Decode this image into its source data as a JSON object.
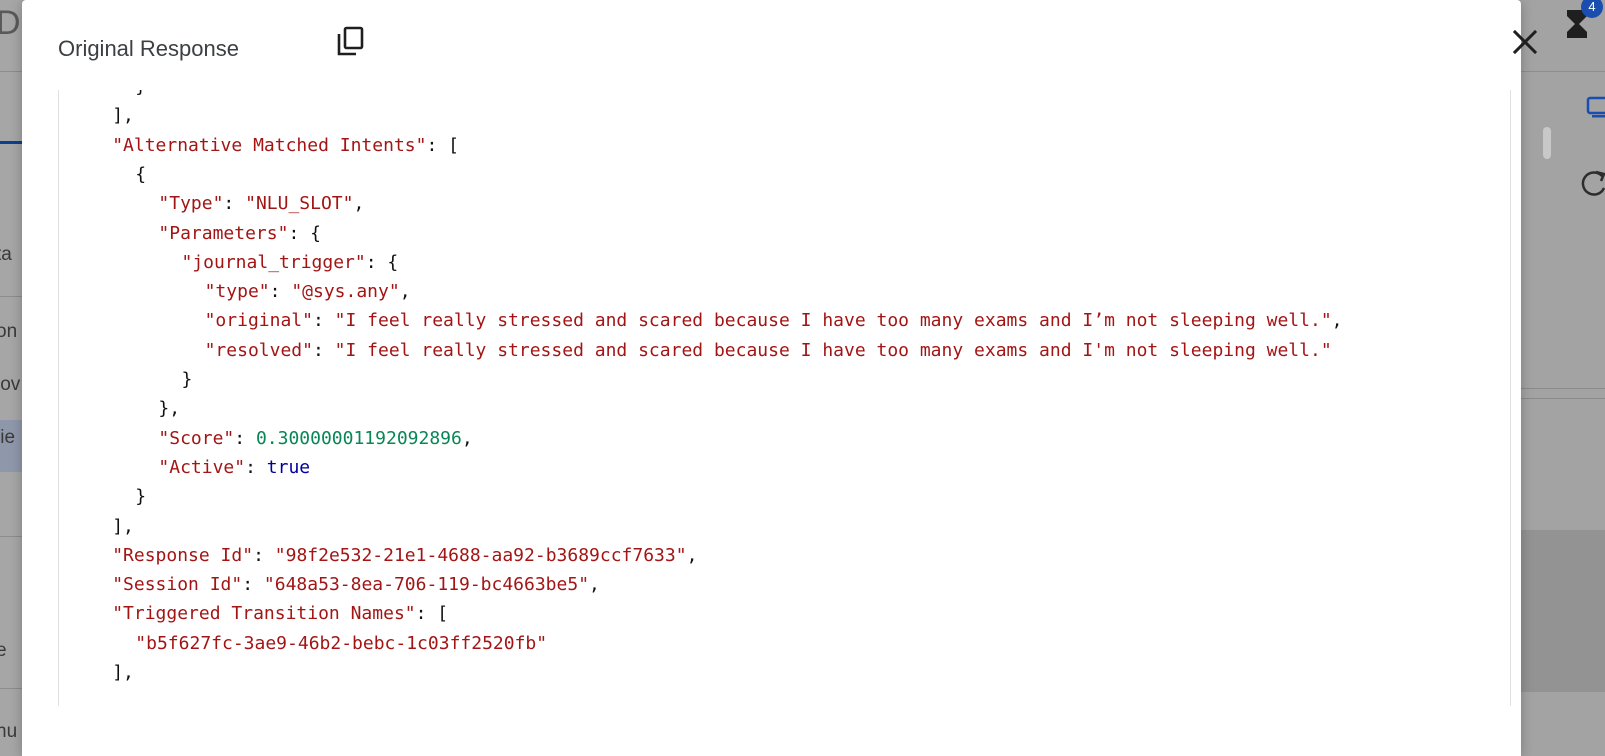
{
  "background": {
    "left_title_fragment": "Di",
    "left_items": [
      "ta",
      "on",
      "lov",
      "lie",
      "e",
      "nu"
    ],
    "notification_count": "4"
  },
  "dialog": {
    "title": "Original Response",
    "copy_icon": "copy-icon",
    "close_icon": "close-icon"
  },
  "code_lines": [
    {
      "indent": 3,
      "tokens": [
        {
          "t": "p",
          "v": "}"
        }
      ]
    },
    {
      "indent": 2,
      "tokens": [
        {
          "t": "p",
          "v": "],"
        }
      ]
    },
    {
      "indent": 2,
      "tokens": [
        {
          "t": "k",
          "v": "\"Alternative Matched Intents\""
        },
        {
          "t": "p",
          "v": ": ["
        }
      ]
    },
    {
      "indent": 3,
      "tokens": [
        {
          "t": "p",
          "v": "{"
        }
      ]
    },
    {
      "indent": 4,
      "tokens": [
        {
          "t": "k",
          "v": "\"Type\""
        },
        {
          "t": "p",
          "v": ": "
        },
        {
          "t": "s",
          "v": "\"NLU_SLOT\""
        },
        {
          "t": "p",
          "v": ","
        }
      ]
    },
    {
      "indent": 4,
      "tokens": [
        {
          "t": "k",
          "v": "\"Parameters\""
        },
        {
          "t": "p",
          "v": ": {"
        }
      ]
    },
    {
      "indent": 5,
      "tokens": [
        {
          "t": "k",
          "v": "\"journal_trigger\""
        },
        {
          "t": "p",
          "v": ": {"
        }
      ]
    },
    {
      "indent": 6,
      "tokens": [
        {
          "t": "k",
          "v": "\"type\""
        },
        {
          "t": "p",
          "v": ": "
        },
        {
          "t": "s",
          "v": "\"@sys.any\""
        },
        {
          "t": "p",
          "v": ","
        }
      ]
    },
    {
      "indent": 6,
      "tokens": [
        {
          "t": "k",
          "v": "\"original\""
        },
        {
          "t": "p",
          "v": ": "
        },
        {
          "t": "s",
          "v": "\"I feel really stressed and scared because I have too many exams and I’m not sleeping well.\""
        },
        {
          "t": "p",
          "v": ","
        }
      ]
    },
    {
      "indent": 6,
      "tokens": [
        {
          "t": "k",
          "v": "\"resolved\""
        },
        {
          "t": "p",
          "v": ": "
        },
        {
          "t": "s",
          "v": "\"I feel really stressed and scared because I have too many exams and I'm not sleeping well.\""
        }
      ]
    },
    {
      "indent": 5,
      "tokens": [
        {
          "t": "p",
          "v": "}"
        }
      ]
    },
    {
      "indent": 4,
      "tokens": [
        {
          "t": "p",
          "v": "},"
        }
      ]
    },
    {
      "indent": 4,
      "tokens": [
        {
          "t": "k",
          "v": "\"Score\""
        },
        {
          "t": "p",
          "v": ": "
        },
        {
          "t": "n",
          "v": "0.30000001192092896"
        },
        {
          "t": "p",
          "v": ","
        }
      ]
    },
    {
      "indent": 4,
      "tokens": [
        {
          "t": "k",
          "v": "\"Active\""
        },
        {
          "t": "p",
          "v": ": "
        },
        {
          "t": "b",
          "v": "true"
        }
      ]
    },
    {
      "indent": 3,
      "tokens": [
        {
          "t": "p",
          "v": "}"
        }
      ]
    },
    {
      "indent": 2,
      "tokens": [
        {
          "t": "p",
          "v": "],"
        }
      ]
    },
    {
      "indent": 2,
      "tokens": [
        {
          "t": "k",
          "v": "\"Response Id\""
        },
        {
          "t": "p",
          "v": ": "
        },
        {
          "t": "s",
          "v": "\"98f2e532-21e1-4688-aa92-b3689ccf7633\""
        },
        {
          "t": "p",
          "v": ","
        }
      ]
    },
    {
      "indent": 2,
      "tokens": [
        {
          "t": "k",
          "v": "\"Session Id\""
        },
        {
          "t": "p",
          "v": ": "
        },
        {
          "t": "s",
          "v": "\"648a53-8ea-706-119-bc4663be5\""
        },
        {
          "t": "p",
          "v": ","
        }
      ]
    },
    {
      "indent": 2,
      "tokens": [
        {
          "t": "k",
          "v": "\"Triggered Transition Names\""
        },
        {
          "t": "p",
          "v": ": ["
        }
      ]
    },
    {
      "indent": 3,
      "tokens": [
        {
          "t": "s",
          "v": "\"b5f627fc-3ae9-46b2-bebc-1c03ff2520fb\""
        }
      ]
    },
    {
      "indent": 2,
      "tokens": [
        {
          "t": "p",
          "v": "],"
        }
      ]
    }
  ]
}
